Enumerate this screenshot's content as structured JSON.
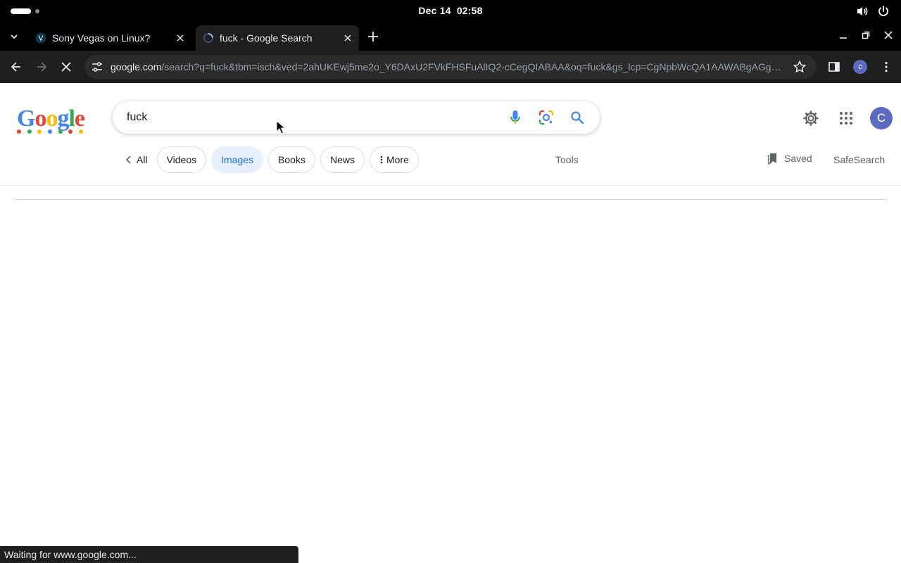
{
  "system": {
    "date": "Dec 14",
    "time": "02:58",
    "icons": [
      "volume-icon",
      "power-icon"
    ]
  },
  "tabs": [
    {
      "title": "Sony Vegas on Linux?",
      "favicon": "V",
      "active": false
    },
    {
      "title": "fuck - Google Search",
      "active": true
    }
  ],
  "toolbar": {
    "url_host": "google.com",
    "url_path": "/search?q=fuck&tbm=isch&ved=2ahUKEwj5me2o_Y6DAxU2FVkFHSFuAlIQ2-cCegQIABAA&oq=fuck&gs_lcp=CgNpbWcQA1AAWABgAGgAc...",
    "profile_initial": "c"
  },
  "search": {
    "query": "fuck"
  },
  "header": {
    "avatar_initial": "C"
  },
  "filters": {
    "back_label": "All",
    "chips": [
      "Videos",
      "Images",
      "Books",
      "News"
    ],
    "more_label": "More",
    "active": "Images",
    "tools_label": "Tools",
    "saved_label": "Saved",
    "safesearch_label": "SafeSearch"
  },
  "status_bar": {
    "text": "Waiting for www.google.com..."
  },
  "colors": {
    "accent_blue": "#1a73e8",
    "chip_active_bg": "#e8f0fe",
    "chrome_dark": "#1f1f1f",
    "avatar": "#5c6bc0"
  }
}
